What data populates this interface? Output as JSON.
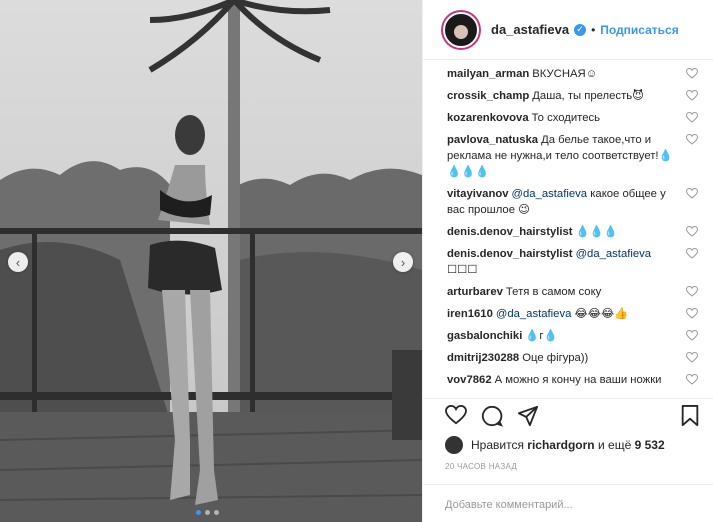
{
  "post": {
    "username": "da_astafieva",
    "follow_label": "Подписаться",
    "separator": "•"
  },
  "carousel": {
    "prev": "‹",
    "next": "›",
    "count": 3,
    "active": 1
  },
  "comments": [
    {
      "user": "mailyan_arman",
      "text": "ВКУСНАЯ☺"
    },
    {
      "user": "crossik_champ",
      "text": "Даша, ты прелесть😈"
    },
    {
      "user": "kozarenkovova",
      "text": "То сходитесь"
    },
    {
      "user": "pavlova_natuska",
      "text": "Да белье такое,что и реклама не нужна,и тело соответствует!💧💧💧💧"
    },
    {
      "user": "vitayivanov",
      "mention": "@da_astafieva",
      "text": "какое общее у вас прошлое 😉"
    },
    {
      "user": "denis.denov_hairstylist",
      "text": "💧💧💧"
    },
    {
      "user": "denis.denov_hairstylist",
      "mention": "@da_astafieva",
      "text": "☐☐☐"
    },
    {
      "user": "arturbarev",
      "text": "Тетя в самом соку"
    },
    {
      "user": "iren1610",
      "mention": "@da_astafieva",
      "text": "😂😂😂👍"
    },
    {
      "user": "gasbalonchiki",
      "text": "💧г💧"
    },
    {
      "user": "dmitrij230288",
      "text": "Оце фігура))"
    },
    {
      "user": "vov7862",
      "text": "А можно я кончу на ваши ножки"
    }
  ],
  "likes": {
    "prefix": "Нравится",
    "user": "richardgorn",
    "middle": "и ещё",
    "count": "9 532"
  },
  "time_ago": "20 часов назад",
  "comment_input": {
    "placeholder": "Добавьте комментарий..."
  },
  "colors": {
    "accent": "#3897f0",
    "text": "#262626",
    "muted": "#999999",
    "border": "#efefef"
  },
  "icons": [
    "heart-icon",
    "comment-icon",
    "share-icon",
    "bookmark-icon",
    "verified-icon",
    "chevron-left-icon",
    "chevron-right-icon"
  ]
}
